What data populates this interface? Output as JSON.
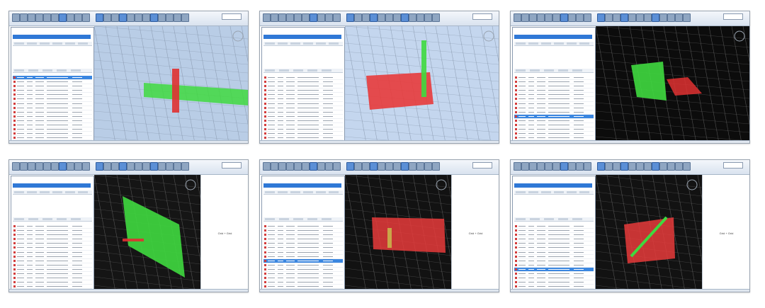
{
  "screens": [
    {
      "name": "screenshot-1",
      "bg": "#b9cde6",
      "panel_band": "#2f78d6",
      "selected_row": 0,
      "box": "#3fd93f",
      "cross": "#e03131",
      "side": false,
      "side_text": ""
    },
    {
      "name": "screenshot-2",
      "bg": "#c4d6ee",
      "panel_band": "#2f78d6",
      "selected_row": -1,
      "box": "#e83b3b",
      "cross": "#3fd93f",
      "side": false,
      "side_text": ""
    },
    {
      "name": "screenshot-3",
      "bg": "#0c0c0c",
      "panel_band": "#2f78d6",
      "selected_row": 9,
      "box": "#3fd93f",
      "cross": "#e03131",
      "side": false,
      "side_text": ""
    },
    {
      "name": "screenshot-4",
      "bg": "#151515",
      "panel_band": "#2f78d6",
      "selected_row": -1,
      "box": "#3fd93f",
      "cross": "#e03131",
      "side": true,
      "side_text": "Grid + Grid"
    },
    {
      "name": "screenshot-5",
      "bg": "#121212",
      "panel_band": "#2f78d6",
      "selected_row": 8,
      "box": "#e83b3b",
      "cross": "#3fd93f",
      "side": true,
      "side_text": "Grid + Grid"
    },
    {
      "name": "screenshot-6",
      "bg": "#121212",
      "panel_band": "#2f78d6",
      "selected_row": 10,
      "box": "#e83b3b",
      "cross": "#3fd93f",
      "side": true,
      "side_text": "Grid + Grid"
    }
  ],
  "icons": {
    "toolbar": "toolbar-icon",
    "clash": "clash-element-icon"
  }
}
